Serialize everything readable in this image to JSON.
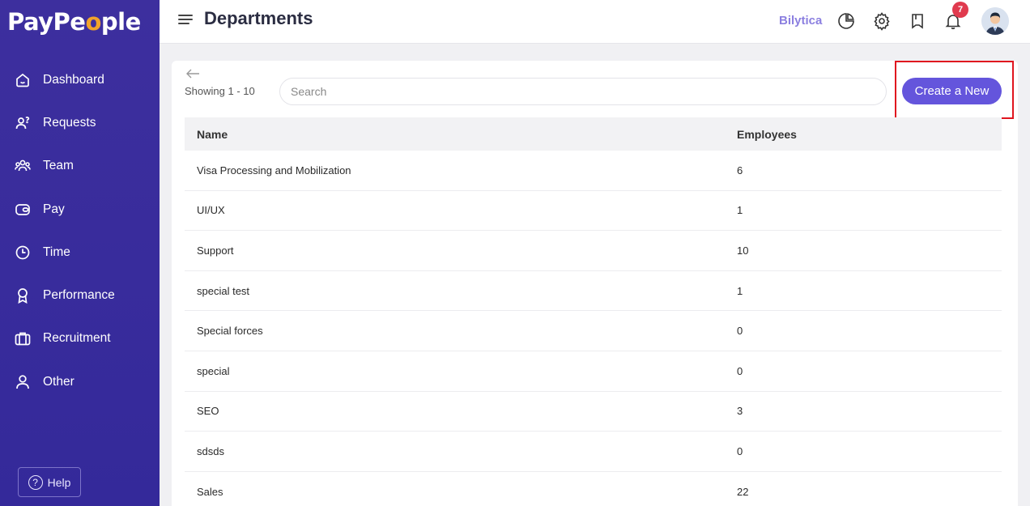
{
  "brand": {
    "logo_text_pre": "PayPe",
    "logo_o": "o",
    "logo_text_post": "ple"
  },
  "sidebar": {
    "items": [
      {
        "label": "Dashboard",
        "icon": "home-icon"
      },
      {
        "label": "Requests",
        "icon": "requests-icon"
      },
      {
        "label": "Team",
        "icon": "team-icon"
      },
      {
        "label": "Pay",
        "icon": "wallet-icon"
      },
      {
        "label": "Time",
        "icon": "clock-icon"
      },
      {
        "label": "Performance",
        "icon": "award-icon"
      },
      {
        "label": "Recruitment",
        "icon": "briefcase-icon"
      },
      {
        "label": "Other",
        "icon": "user-icon"
      }
    ],
    "help_label": "Help"
  },
  "topbar": {
    "title": "Departments",
    "company": "Bilytica",
    "notification_count": "7"
  },
  "toolbar": {
    "showing": "Showing 1 - 10",
    "search_placeholder": "Search",
    "create_label": "Create a New"
  },
  "table": {
    "headers": [
      "Name",
      "Employees"
    ],
    "rows": [
      {
        "name": "Visa Processing and Mobilization",
        "employees": "6"
      },
      {
        "name": "UI/UX",
        "employees": "1"
      },
      {
        "name": "Support",
        "employees": "10"
      },
      {
        "name": "special test",
        "employees": "1"
      },
      {
        "name": "Special forces",
        "employees": "0"
      },
      {
        "name": "special",
        "employees": "0"
      },
      {
        "name": "SEO",
        "employees": "3"
      },
      {
        "name": "sdsds",
        "employees": "0"
      },
      {
        "name": "Sales",
        "employees": "22"
      }
    ]
  },
  "colors": {
    "sidebar": "#3d2f9e",
    "accent": "#6455dc",
    "highlight": "#e0151f",
    "badge": "#e03a4e"
  }
}
